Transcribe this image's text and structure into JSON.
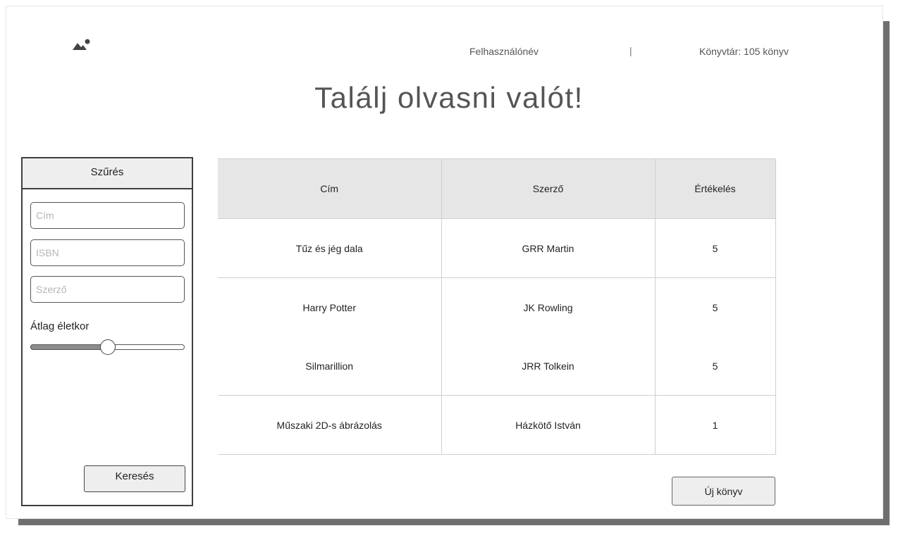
{
  "header": {
    "username": "Felhasználónév",
    "separator": "|",
    "library": "Könyvtár: 105 könyv",
    "title": "Találj olvasni valót!"
  },
  "filter": {
    "heading": "Szűrés",
    "title_placeholder": "Cím",
    "isbn_placeholder": "ISBN",
    "author_placeholder": "Szerző",
    "age_label": "Átlag életkor",
    "age_slider_fraction": 0.5,
    "search_label": "Keresés"
  },
  "table": {
    "columns": [
      "Cím",
      "Szerző",
      "Értékelés"
    ],
    "rows": [
      {
        "title": "Tűz és jég dala",
        "author": "GRR Martin",
        "rating": "5"
      },
      {
        "title": "Harry Potter",
        "author": "JK Rowling",
        "rating": "5"
      },
      {
        "title": "Silmarillion",
        "author": "JRR Tolkein",
        "rating": "5"
      },
      {
        "title": "Műszaki 2D-s ábrázolás",
        "author": "Házkötő István",
        "rating": "1"
      }
    ]
  },
  "actions": {
    "new_book_label": "Új könyv"
  },
  "icons": {
    "logo": "image-placeholder-icon"
  }
}
